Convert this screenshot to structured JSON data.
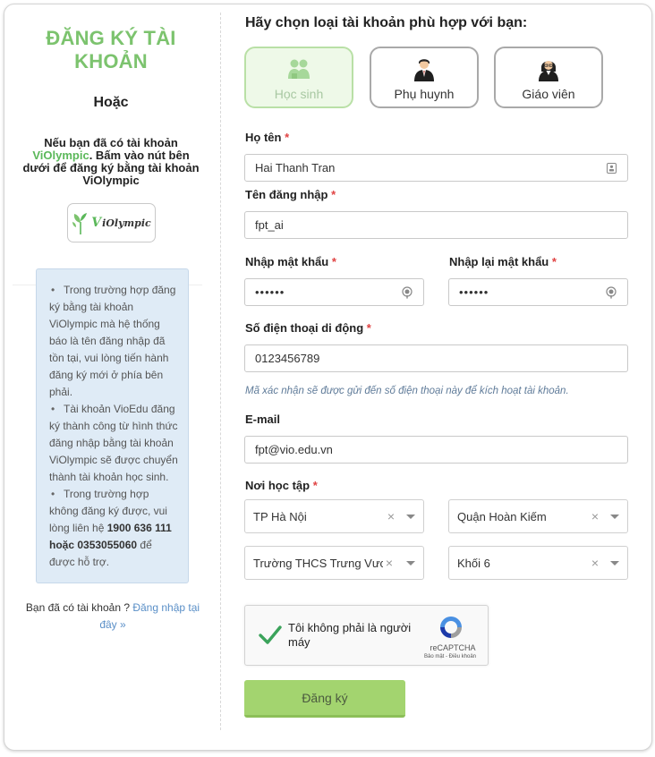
{
  "left": {
    "title": "ĐĂNG KÝ TÀI KHOẢN",
    "or": "Hoặc",
    "desc_prefix": "Nếu bạn đã có tài khoản ",
    "desc_brand": "ViOlympic",
    "desc_suffix": ". Bấm vào nút bên dưới để đăng ký bằng tài khoản ViOlympic",
    "violympic_button": {
      "logo_v": "V",
      "logo_text": "iOlympic"
    },
    "notes": [
      {
        "text": "Trong trường hợp đăng ký bằng tài khoản ViOlympic mà hệ thống báo là tên đăng nhập đã tồn tại, vui lòng tiến hành đăng ký mới ở phía bên phải."
      },
      {
        "text": "Tài khoản VioEdu đăng ký thành công từ hình thức đăng nhập bằng tài khoản ViOlympic sẽ được chuyển thành tài khoản học sinh."
      },
      {
        "text_prefix": "Trong trường hợp không đăng ký được, vui lòng liên hệ ",
        "bold": "1900 636 111 hoặc 0353055060",
        "text_suffix": " để được hỗ trợ."
      }
    ],
    "login_prefix": "Bạn đã có tài khoản ? ",
    "login_link": "Đăng nhập tại đây »"
  },
  "form": {
    "heading": "Hãy chọn loại tài khoản phù hợp với bạn:",
    "roles": [
      {
        "label": "Học sinh",
        "icon": "students-icon",
        "selected": true
      },
      {
        "label": "Phụ huynh",
        "icon": "parent-icon",
        "selected": false
      },
      {
        "label": "Giáo viên",
        "icon": "teacher-icon",
        "selected": false
      }
    ],
    "required_mark": "*",
    "fullname": {
      "label": "Họ tên",
      "value": "Hai Thanh Tran"
    },
    "username": {
      "label": "Tên đăng nhập",
      "value": "fpt_ai"
    },
    "password": {
      "label": "Nhập mật khẩu",
      "value": "••••••"
    },
    "password_confirm": {
      "label": "Nhập lại mật khẩu",
      "value": "••••••"
    },
    "phone": {
      "label": "Số điện thoại di động",
      "value": "0123456789"
    },
    "phone_hint": "Mã xác nhận sẽ được gửi đến số điện thoại này để kích hoạt tài khoản.",
    "email": {
      "label": "E-mail",
      "value": "fpt@vio.edu.vn"
    },
    "school_label": "Nơi học tập",
    "clear_symbol": "×",
    "province": "TP Hà Nội",
    "district": "Quận Hoàn Kiếm",
    "school": "Trường THCS Trưng Vương",
    "grade": "Khối 6",
    "captcha": {
      "text": "Tôi không phải là người máy",
      "brand": "reCAPTCHA",
      "terms": "Bảo mật - Điều khoản"
    },
    "submit": "Đăng ký"
  },
  "colors": {
    "title_green": "#7cc36e",
    "submit_green": "#a3d46f",
    "required_red": "#e04343",
    "note_bg": "#dfebf6"
  }
}
